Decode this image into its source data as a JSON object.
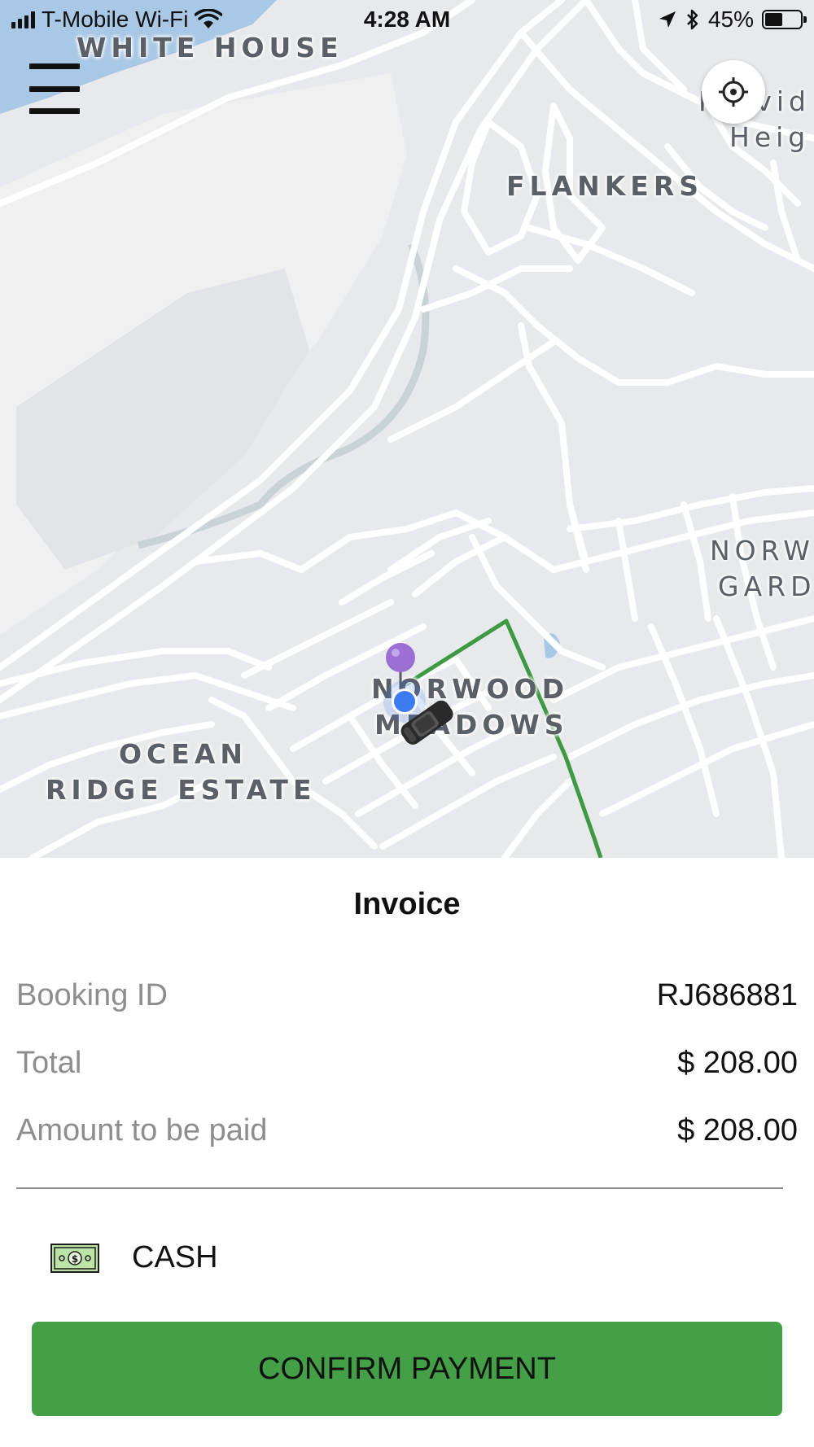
{
  "status_bar": {
    "carrier": "T-Mobile Wi-Fi",
    "time": "4:28 AM",
    "battery": "45%",
    "battery_level": 0.45,
    "icons": [
      "signal-icon",
      "wifi-icon",
      "location-arrow-icon",
      "bluetooth-icon",
      "battery-icon"
    ]
  },
  "map": {
    "labels": {
      "white_house": "WHITE HOUSE",
      "flankers": "FLANKERS",
      "providence_1": "Provid",
      "providence_2": "Heig",
      "norwood_gardens_1": "NORW",
      "norwood_gardens_2": "GARD",
      "norwood_meadows_1": "NORWOOD",
      "norwood_meadows_2": "MEADOWS",
      "ocean_ridge_1": "OCEAN",
      "ocean_ridge_2": "RIDGE ESTATE"
    },
    "colors": {
      "land": "#e8e9ec",
      "water": "#a9c8e6",
      "road": "#ffffff",
      "route": "#3e9a42",
      "pin": "#9b6fd3",
      "user_dot": "#3d7cf0"
    },
    "icons": {
      "menu": "hamburger-menu-icon",
      "locate": "crosshair-locate-icon",
      "destination": "pin-icon",
      "vehicle": "car-icon"
    }
  },
  "invoice": {
    "title": "Invoice",
    "rows": [
      {
        "label": "Booking ID",
        "value": "RJ686881"
      },
      {
        "label": "Total",
        "value": "$ 208.00"
      },
      {
        "label": "Amount to be paid",
        "value": "$ 208.00"
      }
    ],
    "payment_method": {
      "label": "CASH",
      "icon": "cash-banknote-icon"
    },
    "confirm_button": "CONFIRM PAYMENT",
    "colors": {
      "confirm": "#43a047",
      "label": "#8d8d8d"
    }
  }
}
